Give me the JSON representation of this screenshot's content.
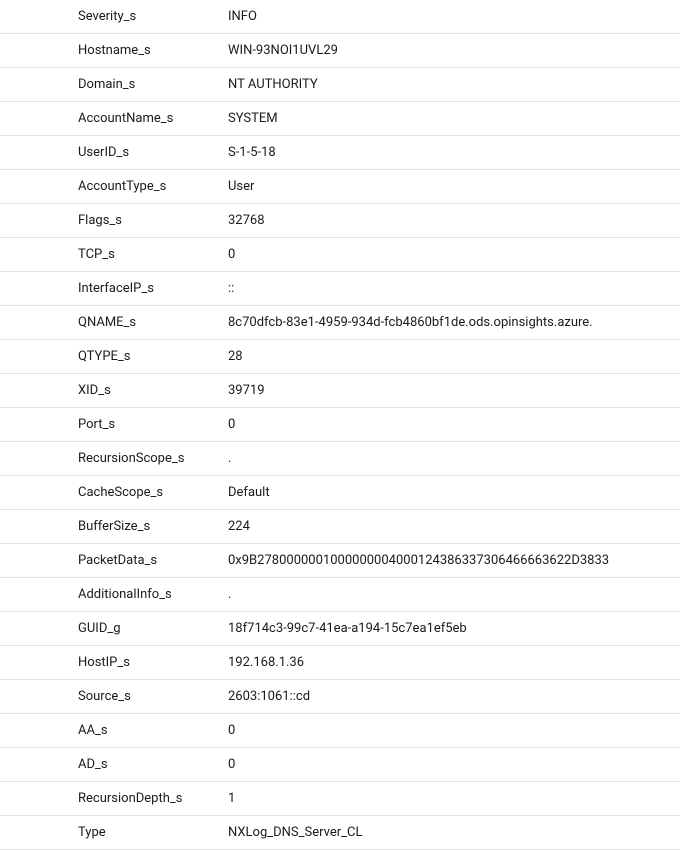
{
  "rows": [
    {
      "key": "Severity_s",
      "value": "INFO"
    },
    {
      "key": "Hostname_s",
      "value": "WIN-93NOI1UVL29"
    },
    {
      "key": "Domain_s",
      "value": "NT AUTHORITY"
    },
    {
      "key": "AccountName_s",
      "value": "SYSTEM"
    },
    {
      "key": "UserID_s",
      "value": "S-1-5-18"
    },
    {
      "key": "AccountType_s",
      "value": "User"
    },
    {
      "key": "Flags_s",
      "value": "32768"
    },
    {
      "key": "TCP_s",
      "value": "0"
    },
    {
      "key": "InterfaceIP_s",
      "value": "::"
    },
    {
      "key": "QNAME_s",
      "value": "8c70dfcb-83e1-4959-934d-fcb4860bf1de.ods.opinsights.azure."
    },
    {
      "key": "QTYPE_s",
      "value": "28"
    },
    {
      "key": "XID_s",
      "value": "39719"
    },
    {
      "key": "Port_s",
      "value": "0"
    },
    {
      "key": "RecursionScope_s",
      "value": "."
    },
    {
      "key": "CacheScope_s",
      "value": "Default"
    },
    {
      "key": "BufferSize_s",
      "value": "224"
    },
    {
      "key": "PacketData_s",
      "value": "0x9B2780000001000000004000124386337306466663622D3833"
    },
    {
      "key": "AdditionalInfo_s",
      "value": "."
    },
    {
      "key": "GUID_g",
      "value": "18f714c3-99c7-41ea-a194-15c7ea1ef5eb"
    },
    {
      "key": "HostIP_s",
      "value": "192.168.1.36"
    },
    {
      "key": "Source_s",
      "value": "2603:1061::cd"
    },
    {
      "key": "AA_s",
      "value": "0"
    },
    {
      "key": "AD_s",
      "value": "0"
    },
    {
      "key": "RecursionDepth_s",
      "value": "1"
    },
    {
      "key": "Type",
      "value": "NXLog_DNS_Server_CL"
    }
  ]
}
